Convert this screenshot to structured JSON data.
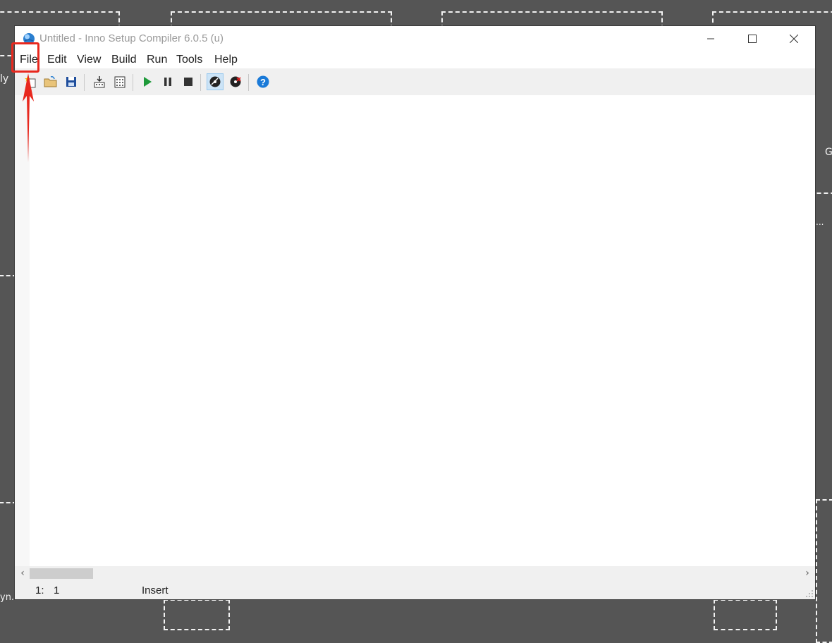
{
  "window": {
    "title": "Untitled - Inno Setup Compiler 6.0.5 (u)",
    "controls": [
      "minimize",
      "maximize",
      "close"
    ]
  },
  "menu": {
    "items": [
      {
        "label": "File"
      },
      {
        "label": "Edit"
      },
      {
        "label": "View"
      },
      {
        "label": "Build"
      },
      {
        "label": "Run"
      },
      {
        "label": "Tools"
      },
      {
        "label": "Help"
      }
    ]
  },
  "toolbar": {
    "buttons": [
      {
        "icon": "new-file-icon"
      },
      {
        "icon": "open-folder-icon"
      },
      {
        "icon": "save-icon"
      },
      {
        "icon": "compile-icon"
      },
      {
        "icon": "stop-compile-icon"
      },
      {
        "icon": "run-icon"
      },
      {
        "icon": "pause-icon"
      },
      {
        "icon": "stop-icon"
      },
      {
        "icon": "target-setup-icon",
        "active": true
      },
      {
        "icon": "target-uninstall-icon"
      },
      {
        "icon": "help-icon"
      }
    ]
  },
  "status": {
    "line": "1:",
    "column": "1",
    "mode": "Insert"
  },
  "desktop": {
    "fragments": [
      "ly",
      "G",
      "...",
      "yn..."
    ]
  },
  "annotation": {
    "target": "File menu",
    "color": "#e8281e"
  }
}
